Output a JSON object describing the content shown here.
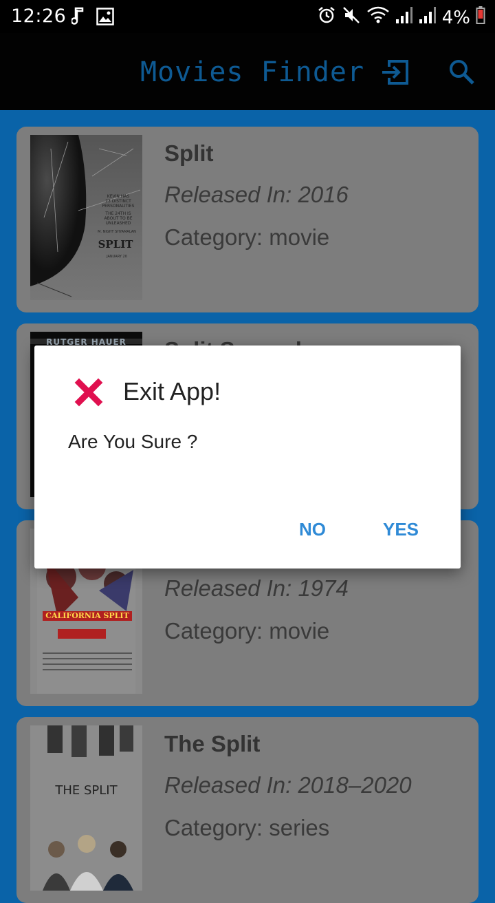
{
  "status_bar": {
    "time": "12:26",
    "battery": "4%"
  },
  "app_bar": {
    "title": "Movies Finder",
    "exit_icon": "exit-to-app-icon",
    "search_icon": "search-icon",
    "title_color": "#0e5a93"
  },
  "movies": [
    {
      "title": "Split",
      "release": "Released In: 2016",
      "category": "Category: movie"
    },
    {
      "title": "Split Second",
      "release": "",
      "category": ""
    },
    {
      "title": "",
      "release": "Released In: 1974",
      "category": "Category: movie"
    },
    {
      "title": "The Split",
      "release": "Released In: 2018–2020",
      "category": "Category: series"
    }
  ],
  "posters": {
    "split": {
      "lines": [
        "KEVIN HAS",
        "23 DISTINCT",
        "PERSONALITIES",
        "THE 24TH IS",
        "ABOUT TO BE",
        "UNLEASHED"
      ],
      "title": "SPLIT",
      "director": "M. NIGHT SHYAMALAN",
      "date": "JANUARY 20"
    },
    "split_second": {
      "header": "RUTGER HAUER"
    },
    "california_split": {
      "title": "CALIFORNIA SPLIT"
    },
    "the_split": {
      "title": "THE SPLIT"
    }
  },
  "dialog": {
    "icon": "red-x-icon",
    "title": "Exit App!",
    "message": "Are You Sure ?",
    "no_label": "NO",
    "yes_label": "YES",
    "accent": "#2f8ad6",
    "icon_color": "#e0104f"
  },
  "colors": {
    "list_background": "#0a63a8",
    "card_background": "#7d7d7d",
    "app_bar": "#020202"
  }
}
